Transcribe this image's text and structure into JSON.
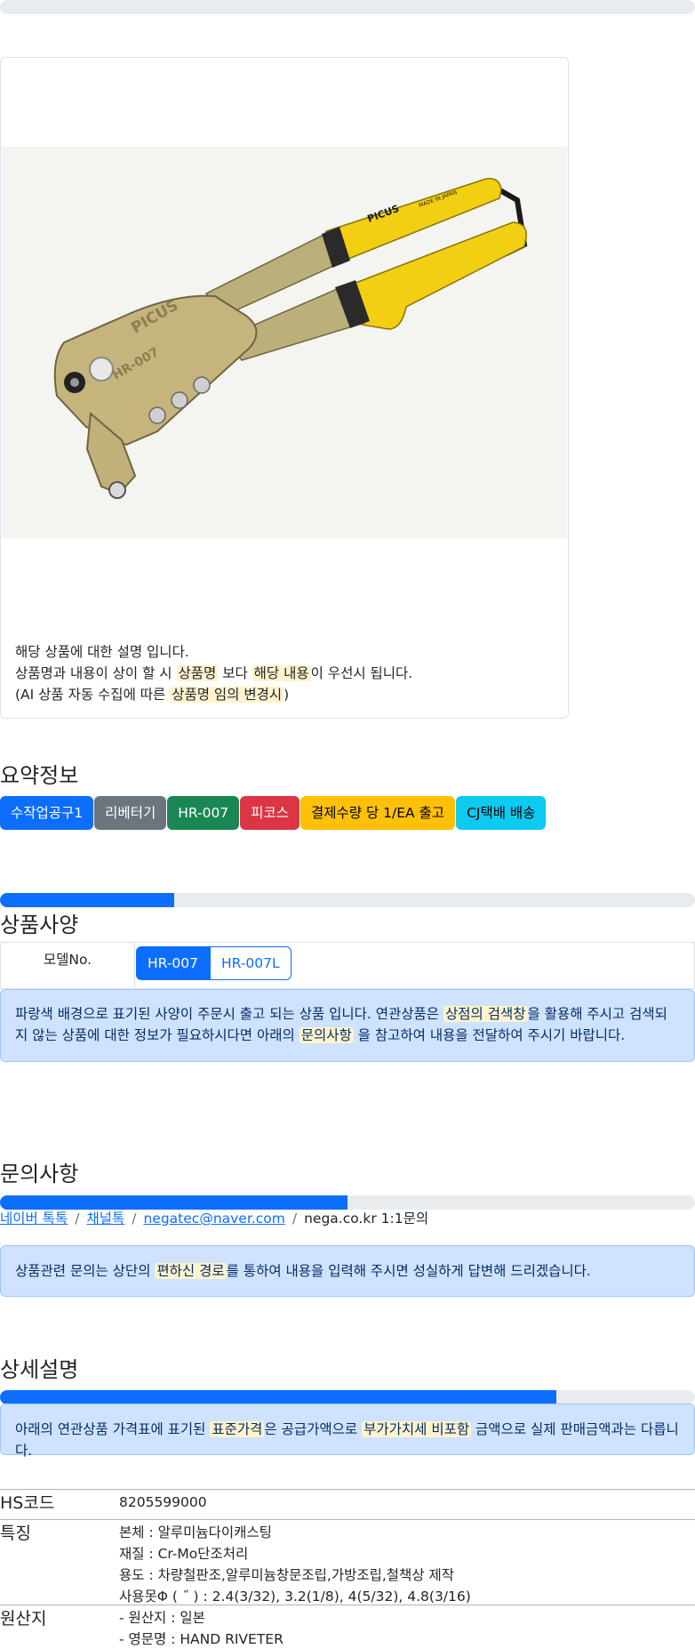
{
  "product_card": {
    "photo_brand": "PICUS",
    "photo_model": "HR-007",
    "photo_made_in": "MADE IN JAPAN",
    "desc_line1": "해당 상품에 대한 설명 입니다.",
    "desc_line2_a": "상품명과 내용이 상이 할 시 ",
    "desc_line2_hl1": "상품명",
    "desc_line2_b": " 보다 ",
    "desc_line2_hl2": "해당 내용",
    "desc_line2_c": "이 우선시 됩니다.",
    "desc_line3_a": "(AI 상품 자동 수집에 따른 ",
    "desc_line3_hl": "상품명 임의 변경시",
    "desc_line3_b": ")"
  },
  "summary": {
    "title": "요약정보",
    "badges": [
      "수작업공구1",
      "리베터기",
      "HR-007",
      "피코스",
      "결제수량 당 1/EA 출고",
      "CJ택배 배송"
    ],
    "progress_fraction": 0.25
  },
  "spec": {
    "title": "상품사양",
    "model_label": "모델No.",
    "models": [
      "HR-007",
      "HR-007L"
    ],
    "alert_a": "파랑색 배경으로 표기된 사양이 주문시 출고 되는 상품 입니다. 연관상품은 ",
    "alert_hl1": "상점의 검색창",
    "alert_b": "을 활용해 주시고 검색되지 않는 상품에 대한 정보가 필요하시다면 아래의 ",
    "alert_hl2": "문의사항",
    "alert_c": " 을 참고하여 내용을 전달하여 주시기 바랍니다."
  },
  "inquiry": {
    "title": "문의사항",
    "progress_fraction": 0.5,
    "links": [
      "네이버 톡톡",
      "채널톡",
      "negatec@naver.com"
    ],
    "separator": "/",
    "plain": "nega.co.kr 1:1문의",
    "alert_a": "상품관련 문의는 상단의 ",
    "alert_hl": "편하신 경로",
    "alert_b": "를 통하여 내용을 입력해 주시면 성실하게 답변해 드리겠습니다."
  },
  "detail": {
    "title": "상세설명",
    "progress_fraction": 0.8,
    "alert_a": "아래의 연관상품 가격표에 표기된 ",
    "alert_hl1": "표준가격",
    "alert_b": "은 공급가액으로 ",
    "alert_hl2": "부가가치세 비포함",
    "alert_c": " 금액으로 실제 판매금액과는 다릅니다.",
    "rows": [
      {
        "key": "HS코드",
        "lines": [
          "8205599000"
        ]
      },
      {
        "key": "특징",
        "lines": [
          "본체 : 알루미늄다이캐스팅",
          "재질 : Cr-Mo단조처리",
          "용도 : 차량철판조,알루미늄창문조립,가방조립,철책상 제작",
          "사용못Φ ( ˝ ) : 2.4(3/32), 3.2(1/8), 4(5/32), 4.8(3/16)"
        ]
      },
      {
        "key": "원산지",
        "lines": [
          "- 원산지 : 일본",
          "- 영문명 : HAND RIVETER"
        ]
      }
    ]
  },
  "colors": {
    "primary": "#0d6efd",
    "secondary": "#6c757d",
    "success": "#198754",
    "danger": "#dc3545",
    "warning": "#ffc107",
    "info": "#0dcaf0",
    "alert_bg": "#cfe2ff",
    "tool_handle_yellow": "#f5d000",
    "tool_body_gold": "#c2b27a"
  }
}
